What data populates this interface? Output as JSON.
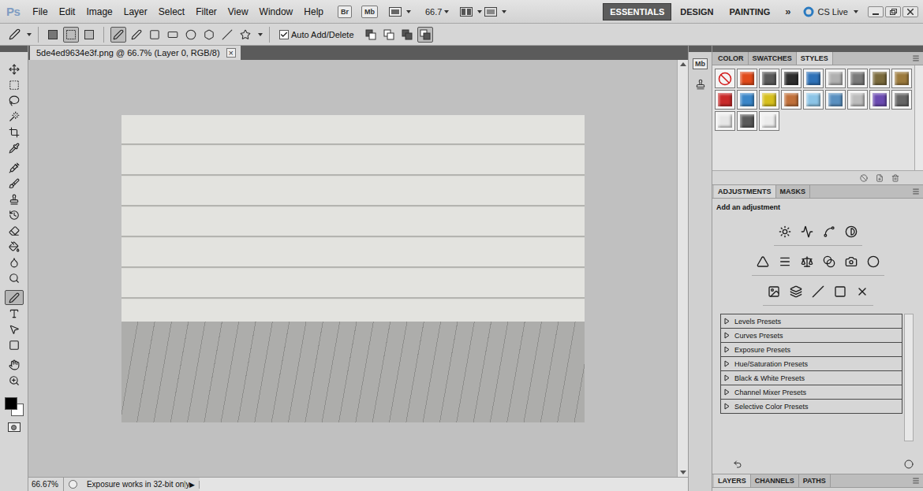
{
  "menu_bar": {
    "logo": "Ps",
    "menus": [
      "File",
      "Edit",
      "Image",
      "Layer",
      "Select",
      "Filter",
      "View",
      "Window",
      "Help"
    ],
    "bridge": "Br",
    "mini_bridge": "Mb",
    "zoom": "66.7",
    "workspaces": [
      {
        "label": "ESSENTIALS",
        "selected": true
      },
      {
        "label": "DESIGN",
        "selected": false
      },
      {
        "label": "PAINTING",
        "selected": false
      }
    ],
    "more": "»",
    "cs_live": "CS Live"
  },
  "options_bar": {
    "modes": [
      {
        "selected": false
      },
      {
        "selected": true
      },
      {
        "selected": false
      }
    ],
    "pens": [
      {
        "selected": true
      },
      {
        "selected": false
      }
    ],
    "auto_add_delete": {
      "label": "Auto Add/Delete",
      "checked": true
    },
    "path_ops": [
      {
        "selected": false
      },
      {
        "selected": false
      },
      {
        "selected": false
      },
      {
        "selected": true
      }
    ]
  },
  "toolbox": {
    "tools": [
      {
        "selected": false
      },
      {
        "selected": false
      },
      {
        "selected": false
      },
      {
        "selected": false
      },
      {
        "selected": false
      },
      {
        "selected": false
      },
      {
        "selected": false
      },
      {
        "selected": false
      },
      {
        "selected": false
      },
      {
        "selected": false
      },
      {
        "selected": false
      },
      {
        "selected": false
      },
      {
        "selected": false
      },
      {
        "selected": false
      },
      {
        "selected": true
      },
      {
        "selected": false
      },
      {
        "selected": false
      },
      {
        "selected": false
      },
      {
        "selected": false
      },
      {
        "selected": false
      }
    ],
    "foreground": "#000000",
    "background": "#ffffff"
  },
  "document": {
    "tab": "5de4ed9634e3f.png @ 66.7% (Layer 0, RGB/8)",
    "close": "×",
    "zoom": "66.67%",
    "status": "Exposure works in 32-bit only",
    "status_menu": "▶"
  },
  "icon_strip": {
    "mini_bridge": "Mb"
  },
  "styles_panel": {
    "tabs": [
      {
        "label": "COLOR",
        "selected": false
      },
      {
        "label": "SWATCHES",
        "selected": false
      },
      {
        "label": "STYLES",
        "selected": true
      }
    ],
    "styles": [
      {
        "kind": "none"
      },
      {
        "kind": "swatch",
        "color": "#e04a1a"
      },
      {
        "kind": "swatch",
        "color": "#5a5a5a"
      },
      {
        "kind": "swatch",
        "color": "#2e2e2e"
      },
      {
        "kind": "swatch",
        "color": "#2f72b8"
      },
      {
        "kind": "swatch",
        "color": "#b0b0b0"
      },
      {
        "kind": "swatch",
        "color": "#7a7a7a"
      },
      {
        "kind": "swatch",
        "color": "#7a6a3c"
      },
      {
        "kind": "swatch",
        "color": "#9c7a3c"
      },
      {
        "kind": "swatch",
        "color": "#c92a2a"
      },
      {
        "kind": "swatch",
        "color": "#3a86c8"
      },
      {
        "kind": "swatch",
        "color": "#d6bf1e"
      },
      {
        "kind": "swatch",
        "color": "#c0703a"
      },
      {
        "kind": "swatch",
        "color": "#8cc4e6"
      },
      {
        "kind": "swatch",
        "color": "#5a90c0"
      },
      {
        "kind": "swatch",
        "color": "#bcbcbc"
      },
      {
        "kind": "swatch",
        "color": "#6a4ab0"
      },
      {
        "kind": "swatch",
        "color": "#666666"
      },
      {
        "kind": "swatch",
        "color": "#e6e6e6"
      },
      {
        "kind": "swatch",
        "color": "#595959"
      },
      {
        "kind": "swatch",
        "color": "#ececec"
      }
    ]
  },
  "adjustments_panel": {
    "tabs": [
      {
        "label": "ADJUSTMENTS",
        "selected": true
      },
      {
        "label": "MASKS",
        "selected": false
      }
    ],
    "heading": "Add an adjustment",
    "presets": [
      {
        "label": "Levels Presets",
        "expanded": false
      },
      {
        "label": "Curves Presets",
        "expanded": false
      },
      {
        "label": "Exposure Presets",
        "expanded": false
      },
      {
        "label": "Hue/Saturation Presets",
        "expanded": false
      },
      {
        "label": "Black & White Presets",
        "expanded": false
      },
      {
        "label": "Channel Mixer Presets",
        "expanded": false
      },
      {
        "label": "Selective Color Presets",
        "expanded": false
      }
    ]
  },
  "bottom_tabs": [
    {
      "label": "LAYERS",
      "selected": true
    },
    {
      "label": "CHANNELS",
      "selected": false
    },
    {
      "label": "PATHS",
      "selected": false
    }
  ]
}
